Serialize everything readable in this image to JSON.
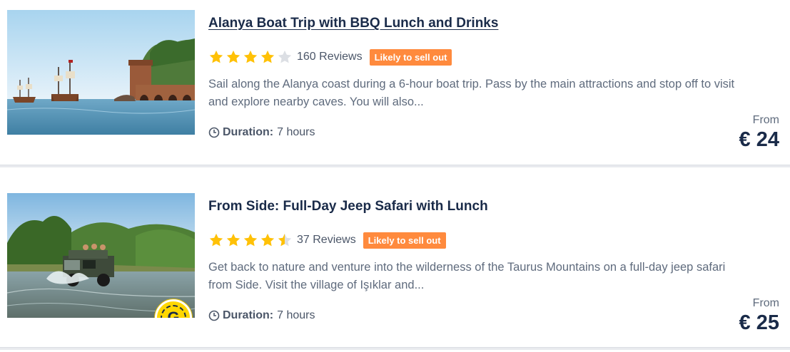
{
  "colors": {
    "title": "#1a2b49",
    "star": "#ffc107",
    "star_empty": "#dcdfe4",
    "badge_bg": "#ff8a3d",
    "text_muted": "#5f6b7d",
    "divider": "#e8eaee"
  },
  "activities": [
    {
      "title": "Alanya Boat Trip with BBQ Lunch and Drinks",
      "rating": 4,
      "reviews": "160 Reviews",
      "badge": "Likely to sell out",
      "description": "Sail along the Alanya coast during a 6-hour boat trip. Pass by the main attractions and stop off to visit and explore nearby caves. You will also...",
      "duration_label": "Duration:",
      "duration_value": "7 hours",
      "price_prefix": "From",
      "price": "€ 24",
      "image_icon": "boat-photo",
      "has_g_badge": false
    },
    {
      "title": "From Side: Full-Day Jeep Safari with Lunch",
      "rating": 4.5,
      "reviews": "37 Reviews",
      "badge": "Likely to sell out",
      "description": "Get back to nature and venture into the wilderness of the Taurus Mountains on a full-day jeep safari from Side. Visit the village of Işıklar and...",
      "duration_label": "Duration:",
      "duration_value": "7 hours",
      "price_prefix": "From",
      "price": "€ 25",
      "image_icon": "jeep-photo",
      "has_g_badge": true,
      "g_badge_letter": "G"
    }
  ]
}
